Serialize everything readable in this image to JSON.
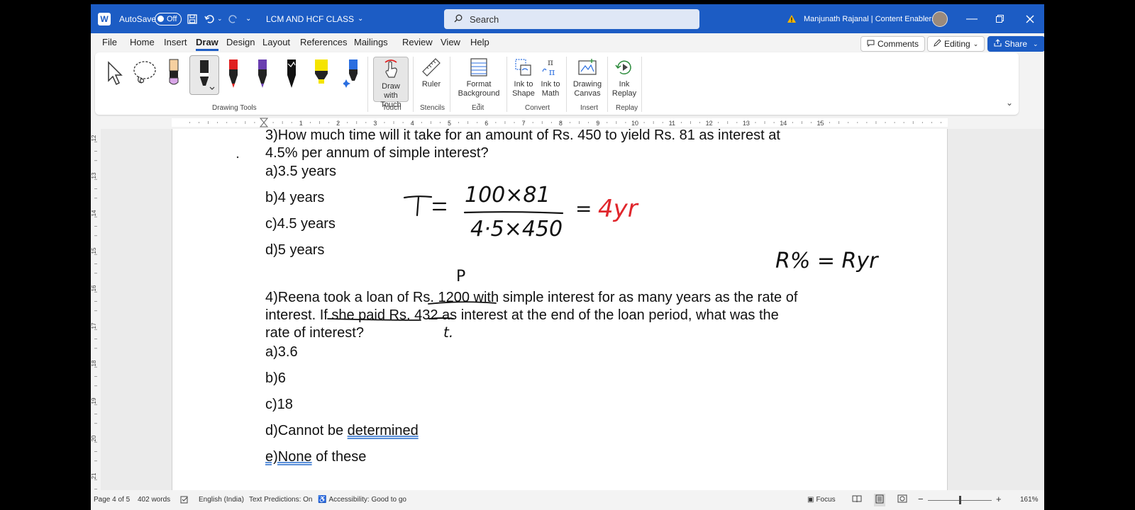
{
  "titlebar": {
    "autosave_label": "AutoSave",
    "autosave_state": "Off",
    "doc_title": "LCM AND HCF CLASS",
    "search_placeholder": "Search",
    "user_name": "Manjunath Rajanal | Content Enablers"
  },
  "menu": [
    "File",
    "Home",
    "Insert",
    "Draw",
    "Design",
    "Layout",
    "References",
    "Mailings",
    "Review",
    "View",
    "Help"
  ],
  "active_menu": "Draw",
  "menu_buttons": {
    "comments": "Comments",
    "editing": "Editing",
    "share": "Share"
  },
  "ribbon": {
    "groups": {
      "drawing_tools": "Drawing Tools",
      "touch": "Touch",
      "stencils": "Stencils",
      "edit": "Edit",
      "convert": "Convert",
      "insert": "Insert",
      "replay": "Replay"
    },
    "draw_with_touch": [
      "Draw with",
      "Touch"
    ],
    "ruler": "Ruler",
    "format_background": [
      "Format",
      "Background"
    ],
    "ink_to_shape": [
      "Ink to",
      "Shape"
    ],
    "ink_to_math": [
      "Ink to",
      "Math"
    ],
    "drawing_canvas": [
      "Drawing",
      "Canvas"
    ],
    "ink_replay": [
      "Ink",
      "Replay"
    ],
    "pen_colors": [
      "#222222",
      "#e02020",
      "#6a3fb0",
      "#111111",
      "#f5e400",
      "#2a6ee0"
    ]
  },
  "ruler_numbers": [
    "1",
    "2",
    "3",
    "4",
    "5",
    "6",
    "7",
    "8",
    "9",
    "10",
    "11",
    "12",
    "13",
    "14",
    "15"
  ],
  "vruler_numbers": [
    "12",
    "13",
    "14",
    "15",
    "16",
    "17",
    "18",
    "19",
    "20",
    "21"
  ],
  "document": {
    "q3_line1": "3)How much time will it take for an amount of Rs. 450 to yield Rs. 81 as interest at",
    "q3_line2": "4.5% per annum of simple interest?",
    "q3_a": "a)3.5 years",
    "q3_b": "b)4 years",
    "q3_c": "c)4.5 years",
    "q3_d": "d)5 years",
    "q4_line1": "4)Reena took a loan of Rs. 1200 with simple interest for as many years as the rate of",
    "q4_line2": "interest. If she paid Rs. 432 as interest at the end of the loan period, what was the",
    "q4_line3": "rate of interest?",
    "q4_a": "a)3.6",
    "q4_b": "b)6",
    "q4_c": "c)18",
    "q4_d_prefix": "d)Cannot be ",
    "q4_d_underlined": "determined",
    "q4_e_underlined": "e)None",
    "q4_e_rest": " of these"
  },
  "ink": {
    "formula_T": "T =",
    "numerator": "100×81",
    "denominator": "4·5×450",
    "equals": "=",
    "answer": "4yr",
    "answer_color": "#e0262c",
    "r_note": "R% = Ryr",
    "p_mark": "P",
    "t_mark": "t."
  },
  "status": {
    "page": "Page 4 of 5",
    "words": "402 words",
    "language": "English (India)",
    "text_predictions": "Text Predictions: On",
    "accessibility": "Accessibility: Good to go",
    "focus": "Focus",
    "zoom": "161%"
  }
}
